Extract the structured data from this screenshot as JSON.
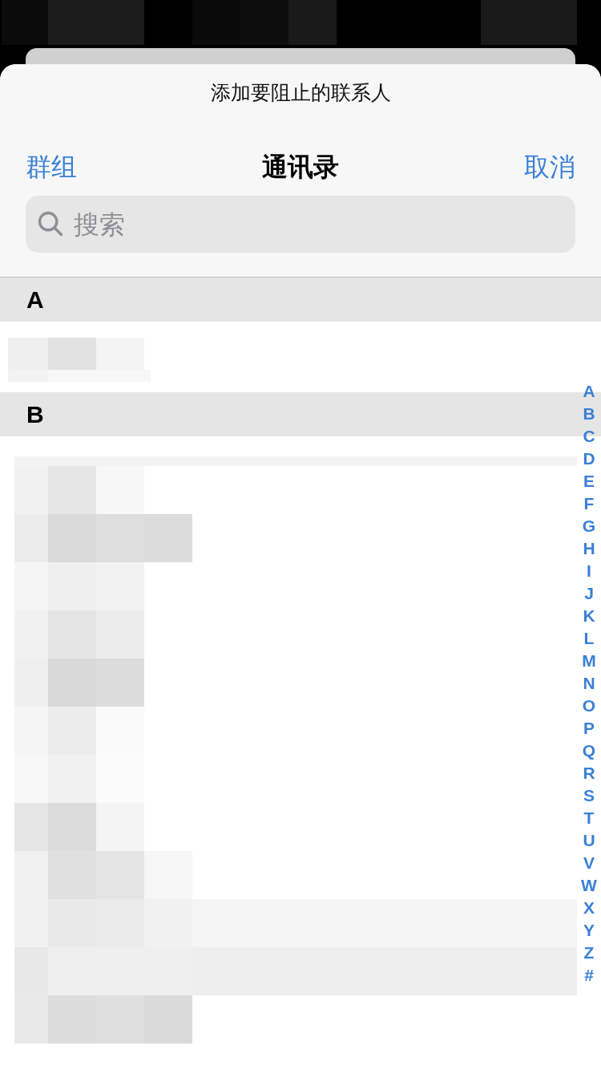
{
  "sheet": {
    "title": "添加要阻止的联系人"
  },
  "nav": {
    "left": "群组",
    "title": "通讯录",
    "right": "取消"
  },
  "search": {
    "placeholder": "搜索"
  },
  "sections": [
    {
      "letter": "A"
    },
    {
      "letter": "B"
    }
  ],
  "index": [
    "A",
    "B",
    "C",
    "D",
    "E",
    "F",
    "G",
    "H",
    "I",
    "J",
    "K",
    "L",
    "M",
    "N",
    "O",
    "P",
    "Q",
    "R",
    "S",
    "T",
    "U",
    "V",
    "W",
    "X",
    "Y",
    "Z",
    "#"
  ]
}
